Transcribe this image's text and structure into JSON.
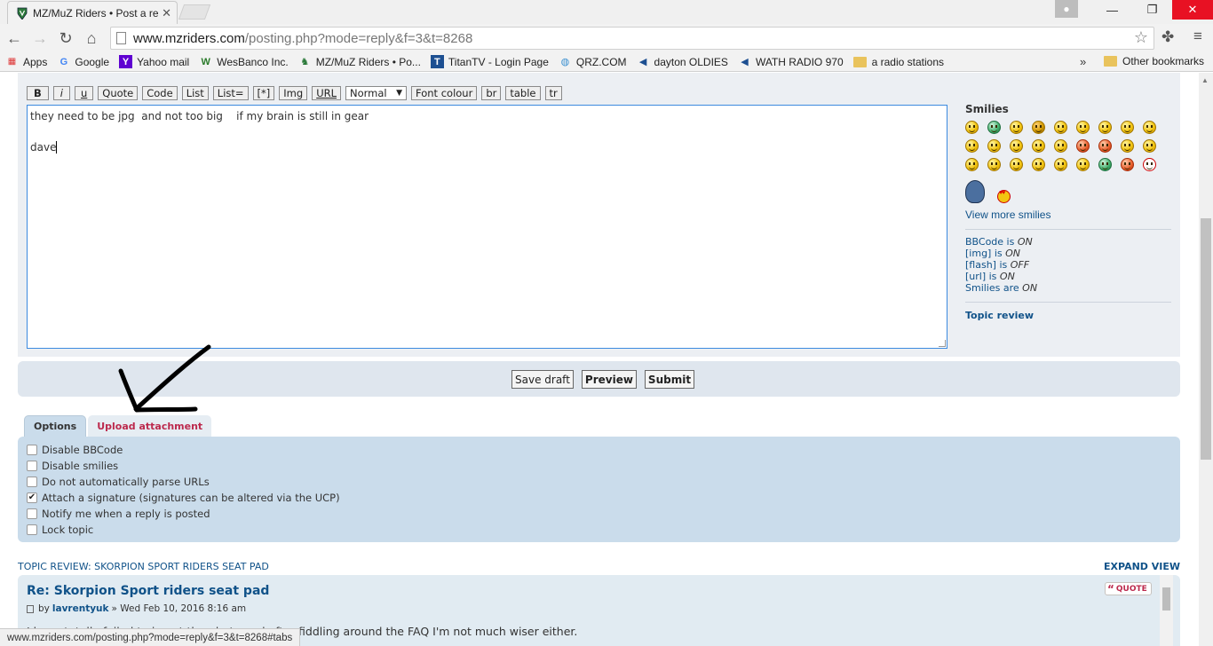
{
  "browser": {
    "tab_title": "MZ/MuZ Riders • Post a re",
    "url_host": "www.mzriders.com",
    "url_path": "/posting.php?mode=reply&f=3&t=8268",
    "bookmarks": [
      {
        "label": "Apps",
        "icon": "apps-grid-icon"
      },
      {
        "label": "Google",
        "icon": "google-icon"
      },
      {
        "label": "Yahoo mail",
        "icon": "yahoo-icon"
      },
      {
        "label": "WesBanco Inc.",
        "icon": "wesbanco-icon"
      },
      {
        "label": "MZ/MuZ Riders • Po...",
        "icon": "mzriders-icon"
      },
      {
        "label": "TitanTV - Login Page",
        "icon": "titantv-icon"
      },
      {
        "label": "QRZ.COM",
        "icon": "globe-icon"
      },
      {
        "label": "dayton OLDIES",
        "icon": "speaker-icon"
      },
      {
        "label": "WATH RADIO 970",
        "icon": "speaker-icon"
      },
      {
        "label": "a radio stations",
        "icon": "folder-icon"
      }
    ],
    "bookmarks_overflow": "»",
    "other_bookmarks": "Other bookmarks",
    "status_url": "www.mzriders.com/posting.php?mode=reply&f=3&t=8268#tabs"
  },
  "editor": {
    "toolbar": [
      "B",
      "i",
      "u",
      "Quote",
      "Code",
      "List",
      "List=",
      "[*]",
      "Img",
      "URL"
    ],
    "font_size_select": "Normal",
    "toolbar_after": [
      "Font colour",
      "br",
      "table",
      "tr"
    ],
    "message": "they need to be jpg  and not too big    if my brain is still in gear\n\ndave"
  },
  "sidebar": {
    "smilies_title": "Smilies",
    "view_more": "View more smilies",
    "status": [
      {
        "label": "BBCode is ",
        "value": "ON"
      },
      {
        "label": "[img] is ",
        "value": "ON"
      },
      {
        "label": "[flash] is ",
        "value": "OFF"
      },
      {
        "label": "[url] is ",
        "value": "ON"
      },
      {
        "label": "Smilies are ",
        "value": "ON"
      }
    ],
    "topic_review": "Topic review"
  },
  "actions": {
    "save_draft": "Save draft",
    "preview": "Preview",
    "submit": "Submit"
  },
  "options_tabs": {
    "options": "Options",
    "upload": "Upload attachment"
  },
  "options": [
    {
      "label": "Disable BBCode",
      "checked": false
    },
    {
      "label": "Disable smilies",
      "checked": false
    },
    {
      "label": "Do not automatically parse URLs",
      "checked": false
    },
    {
      "label": "Attach a signature (signatures can be altered via the UCP)",
      "checked": true
    },
    {
      "label": "Notify me when a reply is posted",
      "checked": false
    },
    {
      "label": "Lock topic",
      "checked": false
    }
  ],
  "review": {
    "heading": "TOPIC REVIEW: SKORPION SPORT RIDERS SEAT PAD",
    "expand": "EXPAND VIEW",
    "post_title": "Re: Skorpion Sport riders seat pad",
    "by": "by",
    "author": "lavrentyuk",
    "date": "» Wed Feb 10, 2016 8:16 am",
    "quote": "QUOTE",
    "body": "I have totally failed to insert the photo and after fiddling around the FAQ I'm not much wiser either."
  }
}
